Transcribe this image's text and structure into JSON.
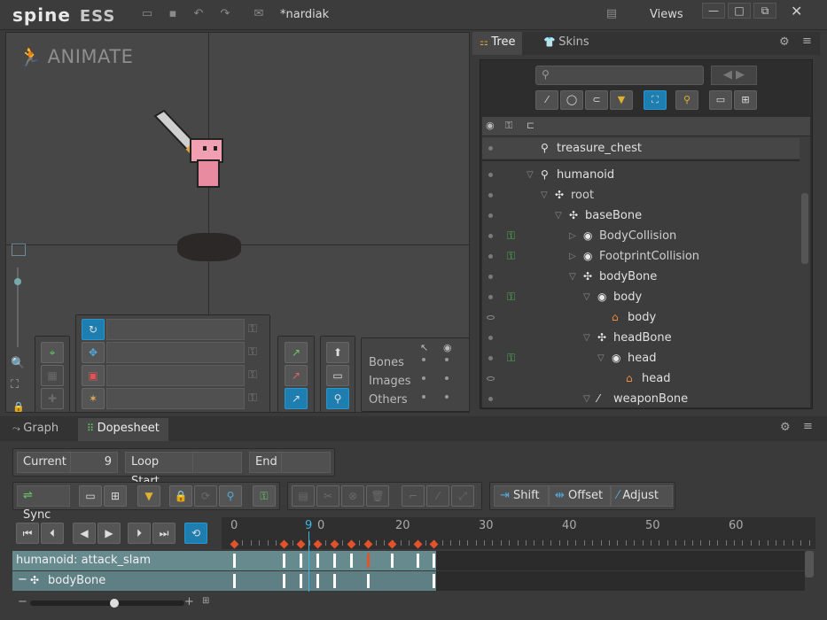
{
  "app": {
    "logo": "spine",
    "edition": "ESS",
    "file": "*nardiak",
    "views_label": "Views"
  },
  "viewport": {
    "mode_label": "ANIMATE"
  },
  "tools": {
    "transform_rows": [
      {
        "icon": "rotate-icon"
      },
      {
        "icon": "translate-icon"
      },
      {
        "icon": "scale-icon"
      },
      {
        "icon": "shear-icon"
      }
    ],
    "visibility": {
      "rows": [
        {
          "label": "Bones"
        },
        {
          "label": "Images"
        },
        {
          "label": "Others"
        }
      ]
    }
  },
  "tree": {
    "tabs": [
      {
        "label": "Tree"
      },
      {
        "label": "Skins"
      }
    ],
    "items": [
      {
        "label": "treasure_chest",
        "icon": "skeleton-icon"
      },
      {
        "label": "humanoid",
        "icon": "skeleton-icon"
      },
      {
        "label": "root",
        "icon": "bone-icon"
      },
      {
        "label": "baseBone",
        "icon": "bone-icon"
      },
      {
        "label": "BodyCollision",
        "icon": "slot-icon"
      },
      {
        "label": "FootprintCollision",
        "icon": "slot-icon"
      },
      {
        "label": "bodyBone",
        "icon": "bone-icon"
      },
      {
        "label": "body",
        "icon": "slot-icon"
      },
      {
        "label": "body",
        "icon": "attachment-icon"
      },
      {
        "label": "headBone",
        "icon": "bone-icon"
      },
      {
        "label": "head",
        "icon": "slot-icon"
      },
      {
        "label": "head",
        "icon": "attachment-icon"
      },
      {
        "label": "weaponBone",
        "icon": "bone-icon"
      }
    ]
  },
  "bottom": {
    "tabs": [
      {
        "label": "Graph"
      },
      {
        "label": "Dopesheet"
      }
    ],
    "current_label": "Current",
    "current_value": "9",
    "loop_start_label": "Loop Start",
    "loop_start_value": "",
    "end_label": "End",
    "end_value": "",
    "sync_label": "Sync",
    "shift_label": "Shift",
    "offset_label": "Offset",
    "adjust_label": "Adjust",
    "ruler_labels": [
      "0",
      "9",
      "0",
      "20",
      "30",
      "40",
      "50",
      "60"
    ],
    "tracks": [
      {
        "label": "humanoid: attack_slam"
      },
      {
        "label": "bodyBone"
      }
    ]
  },
  "colors": {
    "accent": "#1f7eb0",
    "key": "#e2522b",
    "track": "#678a8f",
    "playhead": "#3bb8e6"
  }
}
